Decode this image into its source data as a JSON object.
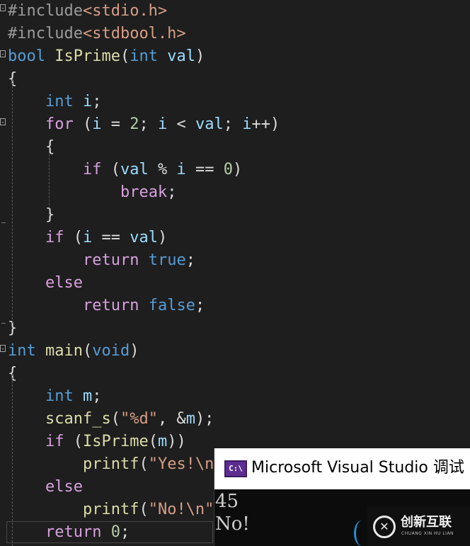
{
  "editor": {
    "lines": [
      {
        "id": "inc1",
        "tokens": [
          {
            "c": "pp",
            "t": "#include"
          },
          {
            "c": "inc",
            "t": "<stdio.h>"
          }
        ]
      },
      {
        "id": "inc2",
        "tokens": [
          {
            "c": "pp",
            "t": "#include"
          },
          {
            "c": "inc",
            "t": "<stdbool.h>"
          }
        ]
      },
      {
        "id": "sig1",
        "tokens": [
          {
            "c": "kw",
            "t": "bool"
          },
          {
            "c": "pun",
            "t": " "
          },
          {
            "c": "fn",
            "t": "IsPrime"
          },
          {
            "c": "pun",
            "t": "("
          },
          {
            "c": "kw",
            "t": "int"
          },
          {
            "c": "pun",
            "t": " "
          },
          {
            "c": "var",
            "t": "val"
          },
          {
            "c": "pun",
            "t": ")"
          }
        ]
      },
      {
        "id": "ob1",
        "tokens": [
          {
            "c": "pun",
            "t": "{"
          }
        ]
      },
      {
        "id": "decl1",
        "tokens": [
          {
            "c": "pun",
            "t": "    "
          },
          {
            "c": "kw",
            "t": "int"
          },
          {
            "c": "pun",
            "t": " "
          },
          {
            "c": "var",
            "t": "i"
          },
          {
            "c": "pun",
            "t": ";"
          }
        ]
      },
      {
        "id": "for1",
        "tokens": [
          {
            "c": "pun",
            "t": "    "
          },
          {
            "c": "ctl",
            "t": "for"
          },
          {
            "c": "pun",
            "t": " ("
          },
          {
            "c": "var",
            "t": "i"
          },
          {
            "c": "pun",
            "t": " = "
          },
          {
            "c": "num",
            "t": "2"
          },
          {
            "c": "pun",
            "t": "; "
          },
          {
            "c": "var",
            "t": "i"
          },
          {
            "c": "pun",
            "t": " < "
          },
          {
            "c": "var",
            "t": "val"
          },
          {
            "c": "pun",
            "t": "; "
          },
          {
            "c": "var",
            "t": "i"
          },
          {
            "c": "pun",
            "t": "++)"
          }
        ]
      },
      {
        "id": "ob2",
        "tokens": [
          {
            "c": "pun",
            "t": "    {"
          }
        ]
      },
      {
        "id": "if1",
        "tokens": [
          {
            "c": "pun",
            "t": "        "
          },
          {
            "c": "ctl",
            "t": "if"
          },
          {
            "c": "pun",
            "t": " ("
          },
          {
            "c": "var",
            "t": "val"
          },
          {
            "c": "pun",
            "t": " % "
          },
          {
            "c": "var",
            "t": "i"
          },
          {
            "c": "pun",
            "t": " == "
          },
          {
            "c": "num",
            "t": "0"
          },
          {
            "c": "pun",
            "t": ")"
          }
        ]
      },
      {
        "id": "brk",
        "tokens": [
          {
            "c": "pun",
            "t": "            "
          },
          {
            "c": "ctl",
            "t": "break"
          },
          {
            "c": "pun",
            "t": ";"
          }
        ]
      },
      {
        "id": "cb2",
        "tokens": [
          {
            "c": "pun",
            "t": "    }"
          }
        ]
      },
      {
        "id": "if2",
        "tokens": [
          {
            "c": "pun",
            "t": "    "
          },
          {
            "c": "ctl",
            "t": "if"
          },
          {
            "c": "pun",
            "t": " ("
          },
          {
            "c": "var",
            "t": "i"
          },
          {
            "c": "pun",
            "t": " == "
          },
          {
            "c": "var",
            "t": "val"
          },
          {
            "c": "pun",
            "t": ")"
          }
        ]
      },
      {
        "id": "ret1",
        "tokens": [
          {
            "c": "pun",
            "t": "        "
          },
          {
            "c": "ctl",
            "t": "return"
          },
          {
            "c": "pun",
            "t": " "
          },
          {
            "c": "kw",
            "t": "true"
          },
          {
            "c": "pun",
            "t": ";"
          }
        ]
      },
      {
        "id": "else1",
        "tokens": [
          {
            "c": "pun",
            "t": "    "
          },
          {
            "c": "ctl",
            "t": "else"
          }
        ]
      },
      {
        "id": "ret2",
        "tokens": [
          {
            "c": "pun",
            "t": "        "
          },
          {
            "c": "ctl",
            "t": "return"
          },
          {
            "c": "pun",
            "t": " "
          },
          {
            "c": "kw",
            "t": "false"
          },
          {
            "c": "pun",
            "t": ";"
          }
        ]
      },
      {
        "id": "cb1",
        "tokens": [
          {
            "c": "pun",
            "t": "}"
          }
        ]
      },
      {
        "id": "main",
        "tokens": [
          {
            "c": "kw",
            "t": "int"
          },
          {
            "c": "pun",
            "t": " "
          },
          {
            "c": "fn",
            "t": "main"
          },
          {
            "c": "pun",
            "t": "("
          },
          {
            "c": "kw",
            "t": "void"
          },
          {
            "c": "pun",
            "t": ")"
          }
        ]
      },
      {
        "id": "ob3",
        "tokens": [
          {
            "c": "pun",
            "t": "{"
          }
        ]
      },
      {
        "id": "decl2",
        "tokens": [
          {
            "c": "pun",
            "t": "    "
          },
          {
            "c": "kw",
            "t": "int"
          },
          {
            "c": "pun",
            "t": " "
          },
          {
            "c": "var",
            "t": "m"
          },
          {
            "c": "pun",
            "t": ";"
          }
        ]
      },
      {
        "id": "scan",
        "tokens": [
          {
            "c": "pun",
            "t": "    "
          },
          {
            "c": "fn",
            "t": "scanf_s"
          },
          {
            "c": "pun",
            "t": "("
          },
          {
            "c": "str",
            "t": "\"%d\""
          },
          {
            "c": "pun",
            "t": ", &"
          },
          {
            "c": "var",
            "t": "m"
          },
          {
            "c": "pun",
            "t": ");"
          }
        ]
      },
      {
        "id": "if3",
        "tokens": [
          {
            "c": "pun",
            "t": "    "
          },
          {
            "c": "ctl",
            "t": "if"
          },
          {
            "c": "pun",
            "t": " ("
          },
          {
            "c": "fn",
            "t": "IsPrime"
          },
          {
            "c": "pun",
            "t": "("
          },
          {
            "c": "var",
            "t": "m"
          },
          {
            "c": "pun",
            "t": "))"
          }
        ]
      },
      {
        "id": "pf1",
        "tokens": [
          {
            "c": "pun",
            "t": "        "
          },
          {
            "c": "fn",
            "t": "printf"
          },
          {
            "c": "pun",
            "t": "("
          },
          {
            "c": "str",
            "t": "\"Yes!\\n"
          }
        ]
      },
      {
        "id": "else2",
        "tokens": [
          {
            "c": "pun",
            "t": "    "
          },
          {
            "c": "ctl",
            "t": "else"
          }
        ]
      },
      {
        "id": "pf2",
        "tokens": [
          {
            "c": "pun",
            "t": "        "
          },
          {
            "c": "fn",
            "t": "printf"
          },
          {
            "c": "pun",
            "t": "("
          },
          {
            "c": "str",
            "t": "\"No!\\n\""
          },
          {
            "c": "pun",
            "t": ")"
          }
        ]
      },
      {
        "id": "ret3",
        "tokens": [
          {
            "c": "pun",
            "t": "    "
          },
          {
            "c": "ctl",
            "t": "return"
          },
          {
            "c": "pun",
            "t": " "
          },
          {
            "c": "num",
            "t": "0"
          },
          {
            "c": "pun",
            "t": ";"
          }
        ]
      }
    ]
  },
  "console": {
    "title": "Microsoft Visual Studio 调试",
    "icon_text": "C:\\",
    "icon": "console-app-icon",
    "output": [
      "45",
      "No!"
    ]
  },
  "watermark": {
    "name": "创新互联",
    "subtitle": "CHUANG XIN HU LIAN",
    "logo_glyph": "✕"
  },
  "colors": {
    "background": "#1e1e1e",
    "keyword": "#569cd6",
    "control": "#d8a0df",
    "function": "#dcdcaa",
    "variable": "#9cdcfe",
    "string": "#d69d85",
    "number": "#b5cea8",
    "console_bg": "#0c0c0c"
  }
}
